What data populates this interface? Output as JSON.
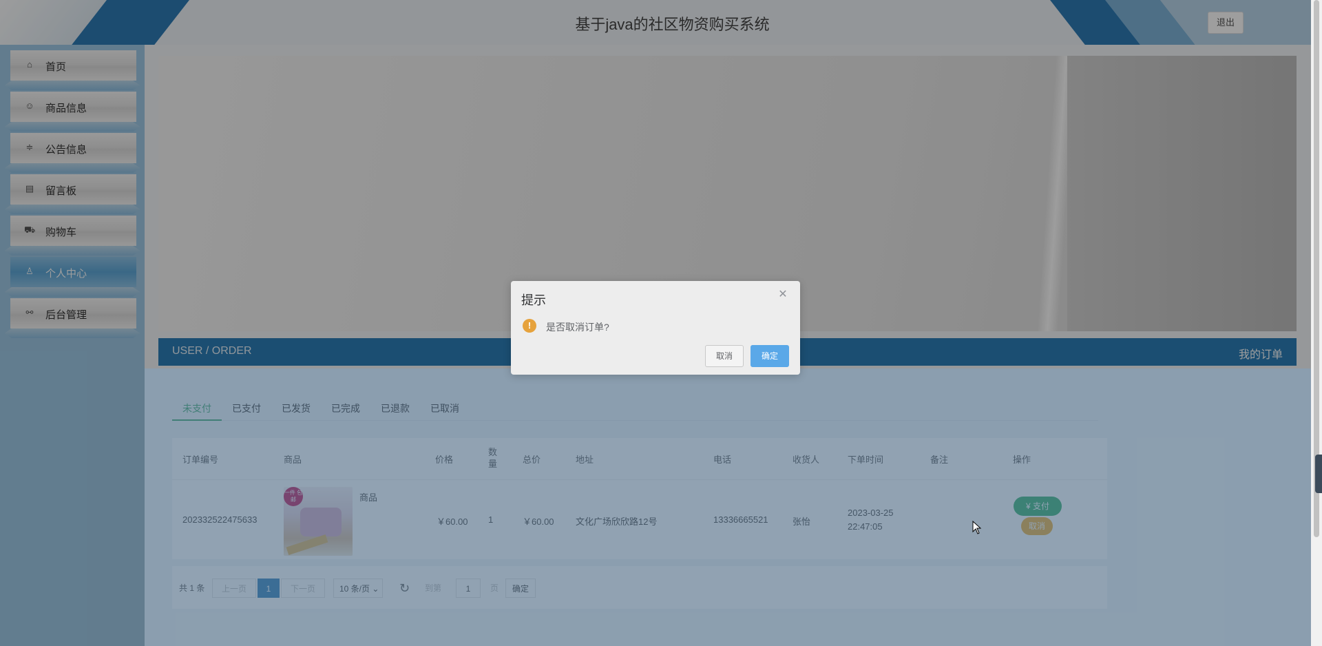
{
  "header": {
    "title": "基于java的社区物资购买系统",
    "logout_label": "退出"
  },
  "sidebar": {
    "items": [
      {
        "label": "首页",
        "icon": "home-icon"
      },
      {
        "label": "商品信息",
        "icon": "goods-icon"
      },
      {
        "label": "公告信息",
        "icon": "sliders-icon"
      },
      {
        "label": "留言板",
        "icon": "notebook-icon"
      },
      {
        "label": "购物车",
        "icon": "cart-icon"
      },
      {
        "label": "个人中心",
        "icon": "user-icon",
        "active": true
      },
      {
        "label": "后台管理",
        "icon": "link-icon"
      }
    ]
  },
  "section_bar": {
    "en_title": "USER / ORDER",
    "cn_title": "我的订单"
  },
  "tabs": [
    {
      "label": "未支付",
      "active": true
    },
    {
      "label": "已支付"
    },
    {
      "label": "已发货"
    },
    {
      "label": "已完成"
    },
    {
      "label": "已退款"
    },
    {
      "label": "已取消"
    }
  ],
  "table": {
    "headers": {
      "order_no": "订单编号",
      "product": "商品",
      "price": "价格",
      "qty": "数量",
      "total": "总价",
      "address": "地址",
      "phone": "电话",
      "receiver": "收货人",
      "order_time": "下单时间",
      "remark": "备注",
      "action": "操作"
    },
    "rows": [
      {
        "order_no": "202332522475633",
        "product_name": "商品",
        "product_image_badge": "一件 包邮",
        "price": "￥60.00",
        "qty": "1",
        "total": "￥60.00",
        "address": "文化广场欣欣路12号",
        "phone": "13336665521",
        "receiver": "张怡",
        "order_date": "2023-03-25",
        "order_clock": "22:47:05",
        "remark": "",
        "pay_label": "支付",
        "cancel_label": "取消"
      }
    ]
  },
  "pager": {
    "total": "共 1 条",
    "prev": "上一页",
    "current": "1",
    "next": "下一页",
    "page_size": "10 条/页",
    "goto_label": "到第",
    "goto_value": "1",
    "page_unit": "页",
    "confirm": "确定"
  },
  "dialog": {
    "title": "提示",
    "message": "是否取消订单?",
    "cancel_label": "取消",
    "ok_label": "确定",
    "warn_glyph": "!"
  },
  "colors": {
    "brand_blue": "#2d7fb8",
    "sidebar_bg": "#9ec9e6",
    "active_tab": "#3aa76d",
    "pay_green": "#2fae6a",
    "cancel_orange": "#f0ad2e",
    "dialog_ok": "#5aa8e8",
    "warning": "#e6a23c"
  }
}
